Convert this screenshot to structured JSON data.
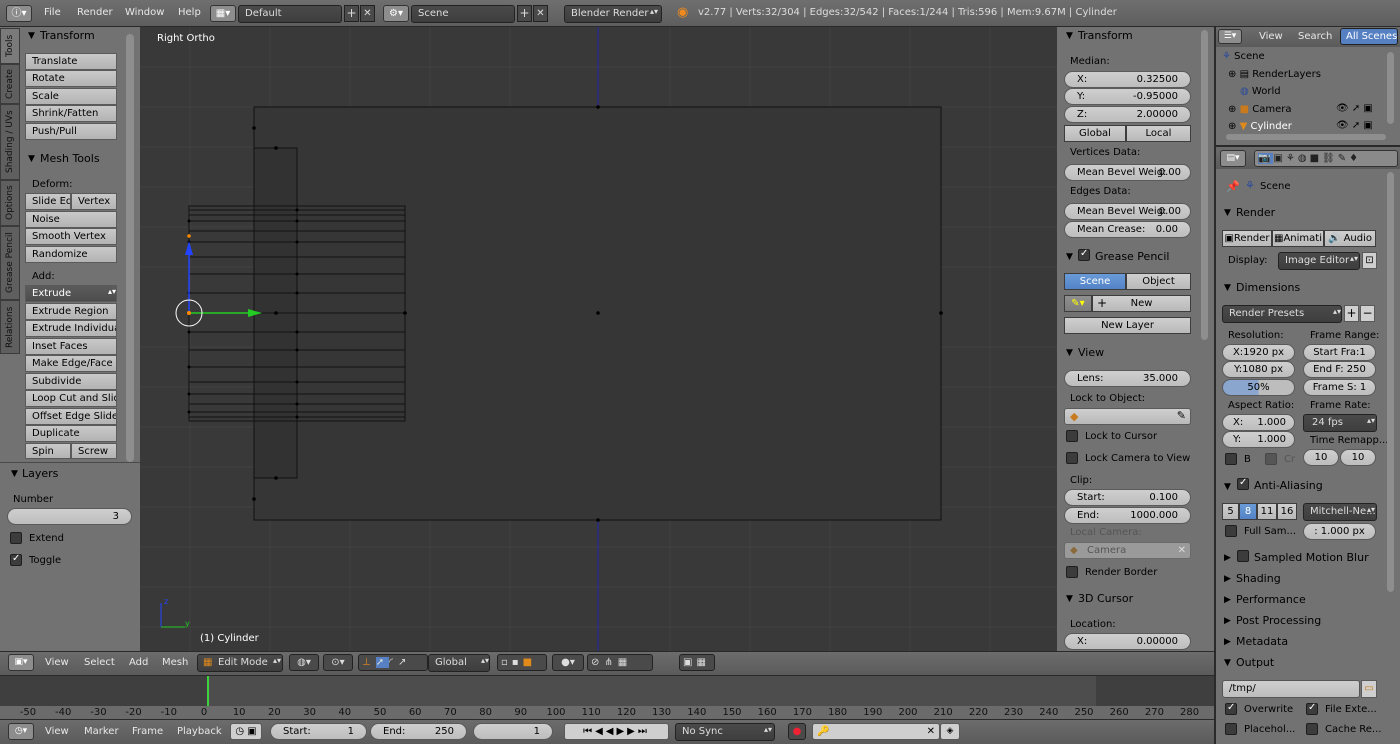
{
  "topbar": {
    "menus": [
      "File",
      "Render",
      "Window",
      "Help"
    ],
    "layout": "Default",
    "scene": "Scene",
    "engine": "Blender Render",
    "stats": "v2.77 | Verts:32/304 | Edges:32/542 | Faces:1/244 | Tris:596 | Mem:9.67M | Cylinder"
  },
  "tool_tabs": [
    "Tools",
    "Create",
    "Shading / UVs",
    "Options",
    "Grease Pencil",
    "Relations"
  ],
  "tools": {
    "transform_header": "Transform",
    "transform": [
      "Translate",
      "Rotate",
      "Scale",
      "Shrink/Fatten",
      "Push/Pull"
    ],
    "mesh_header": "Mesh Tools",
    "deform_label": "Deform:",
    "slide_edge": "Slide Ed",
    "vertex": "Vertex",
    "deform": [
      "Noise",
      "Smooth Vertex",
      "Randomize"
    ],
    "add_label": "Add:",
    "extrude": "Extrude",
    "add": [
      "Extrude Region",
      "Extrude Individual",
      "Inset Faces",
      "Make Edge/Face",
      "Subdivide",
      "Loop Cut and Slide",
      "Offset Edge Slide",
      "Duplicate"
    ],
    "spin": "Spin",
    "screw": "Screw"
  },
  "layers": {
    "header": "Layers",
    "number_label": "Number",
    "number": "3",
    "extend": "Extend",
    "toggle": "Toggle"
  },
  "viewport": {
    "view_name": "Right Ortho",
    "object_name": "(1) Cylinder",
    "axis_z": "z",
    "axis_y": "y"
  },
  "props": {
    "transform_header": "Transform",
    "median": "Median:",
    "x_label": "X:",
    "x": "0.32500",
    "y_label": "Y:",
    "y": "-0.95000",
    "z_label": "Z:",
    "z": "2.00000",
    "global": "Global",
    "local": "Local",
    "vertices_data": "Vertices Data:",
    "mean_bevel_label": "Mean Bevel Weig:",
    "mean_bevel_v": "0.00",
    "edges_data": "Edges Data:",
    "mean_bevel_e": "0.00",
    "mean_crease_label": "Mean Crease:",
    "mean_crease": "0.00",
    "grease_header": "Grease Pencil",
    "scene": "Scene",
    "object": "Object",
    "new": "New",
    "new_layer": "New Layer",
    "view_header": "View",
    "lens_label": "Lens:",
    "lens": "35.000",
    "lock_object": "Lock to Object:",
    "lock_cursor": "Lock to Cursor",
    "lock_camera": "Lock Camera to View",
    "clip": "Clip:",
    "start_label": "Start:",
    "start": "0.100",
    "end_label": "End:",
    "end": "1000.000",
    "local_camera": "Local Camera:",
    "camera": "Camera",
    "render_border": "Render Border",
    "cursor_header": "3D Cursor",
    "location": "Location:",
    "cx_label": "X:",
    "cx": "0.00000"
  },
  "outliner": {
    "view": "View",
    "search": "Search",
    "all_scenes": "All Scenes",
    "items": [
      "Scene",
      "RenderLayers",
      "World",
      "Camera",
      "Cylinder"
    ]
  },
  "render": {
    "scene_label": "Scene",
    "render_header": "Render",
    "render_btn": "Render",
    "anim_btn": "Animati",
    "audio_btn": "Audio",
    "display_label": "Display:",
    "display": "Image Editor",
    "dimensions_header": "Dimensions",
    "presets": "Render Presets",
    "resolution": "Resolution:",
    "res_x": "X:1920 px",
    "res_y": "Y:1080 px",
    "res_pct": "50%",
    "frame_range": "Frame Range:",
    "start_frame": "Start Fra:1",
    "end_frame": "End F: 250",
    "frame_step": "Frame S: 1",
    "aspect": "Aspect Ratio:",
    "asp_x_label": "X:",
    "asp_x": "1.000",
    "asp_y_label": "Y:",
    "asp_y": "1.000",
    "frame_rate": "Frame Rate:",
    "fps": "24 fps",
    "time_remap": "Time Remapp...",
    "remap_a": "10",
    "remap_b": "10",
    "b_label": "B",
    "cr_label": "Cr",
    "aa_header": "Anti-Aliasing",
    "aa_levels": [
      "5",
      "8",
      "11",
      "16"
    ],
    "aa_filter": "Mitchell-Ne...",
    "full_sample": "Full Sam...",
    "filter_size": ": 1.000 px",
    "motion_blur": "Sampled Motion Blur",
    "shading": "Shading",
    "performance": "Performance",
    "post": "Post Processing",
    "metadata": "Metadata",
    "output": "Output",
    "path": "/tmp/",
    "overwrite": "Overwrite",
    "file_ext": "File Exte...",
    "placeholders": "Placehol...",
    "cache": "Cache Re..."
  },
  "view3d_header": {
    "menus": [
      "View",
      "Select",
      "Add",
      "Mesh"
    ],
    "mode": "Edit Mode",
    "orientation": "Global"
  },
  "timeline": {
    "ticks": [
      "-50",
      "-40",
      "-30",
      "-20",
      "-10",
      "0",
      "10",
      "20",
      "30",
      "40",
      "50",
      "60",
      "70",
      "80",
      "90",
      "100",
      "110",
      "120",
      "130",
      "140",
      "150",
      "160",
      "170",
      "180",
      "190",
      "200",
      "210",
      "220",
      "230",
      "240",
      "250",
      "260",
      "270",
      "280"
    ],
    "menus": [
      "View",
      "Marker",
      "Frame",
      "Playback"
    ],
    "start_label": "Start:",
    "start": "1",
    "end_label": "End:",
    "end": "250",
    "current": "1",
    "sync": "No Sync"
  },
  "colors": {
    "viewport_bg": "#393939",
    "panel_bg": "#727272",
    "blue_active": "#5680c2",
    "manip_x": "#22cc22",
    "manip_z": "#2244ff"
  }
}
